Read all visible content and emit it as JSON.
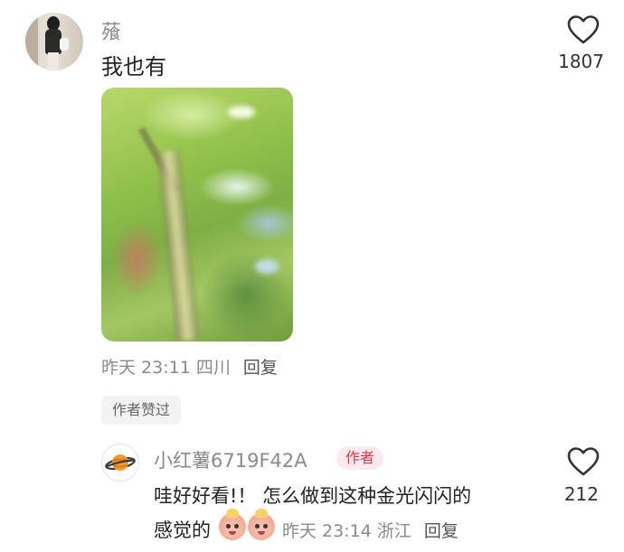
{
  "comment": {
    "username": "蕵",
    "text": "我也有",
    "like_count": "1807",
    "meta": {
      "time": "昨天 23:11",
      "location": "四川",
      "reply_label": "回复"
    },
    "author_liked_label": "作者赞过"
  },
  "reply": {
    "username": "小红薯6719F42A",
    "author_badge": "作者",
    "text_line1": "哇好好看!！ 怎么做到这种金光闪闪的",
    "text_line2": "感觉的",
    "emoji_names": [
      "blushing-face-emoji",
      "blushing-face-emoji"
    ],
    "like_count": "212",
    "meta": {
      "time": "昨天 23:14",
      "location": "浙江",
      "reply_label": "回复"
    }
  },
  "colors": {
    "badge_text": "#e0334b",
    "badge_bg": "#fdeaec",
    "muted_text": "#8a8a8a"
  }
}
